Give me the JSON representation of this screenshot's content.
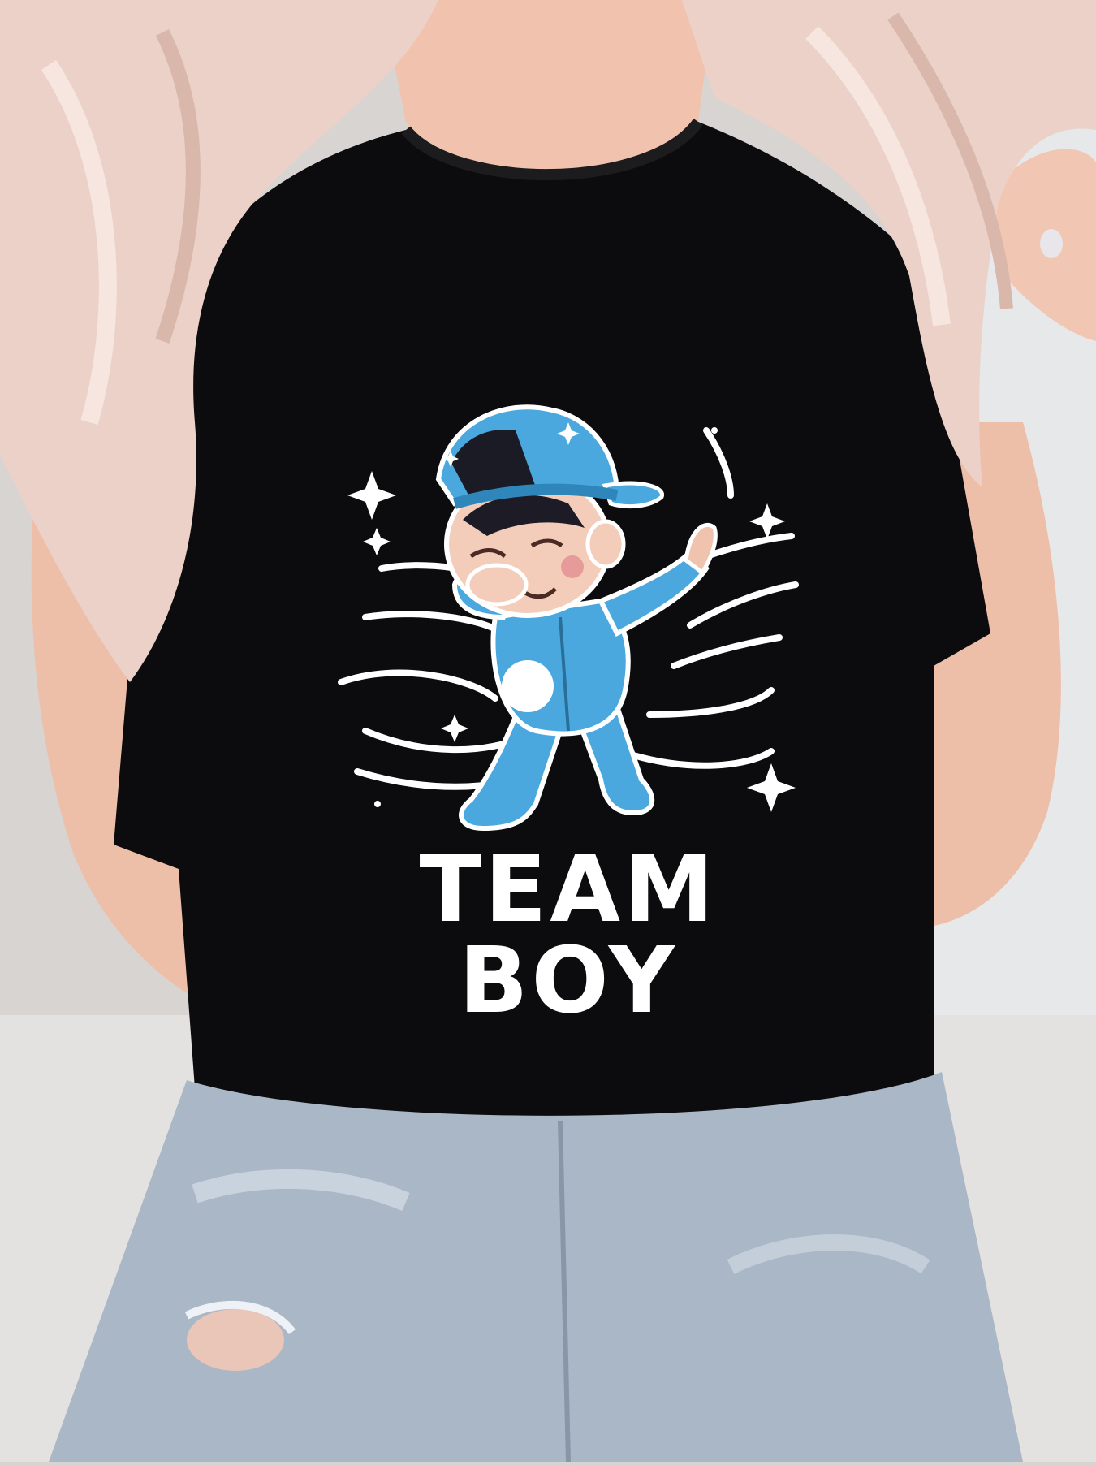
{
  "photo": {
    "subject": "woman-wearing-printed-tshirt",
    "shirt_color": "#0c0c0e",
    "jeans_color": "#a9b7c6",
    "hair_color": "#e9cfc6",
    "skin_color": "#f0c3b0"
  },
  "print": {
    "caption": "TEAM BOY",
    "outfit_color": "#4aa8de",
    "outline_color": "#ffffff"
  }
}
